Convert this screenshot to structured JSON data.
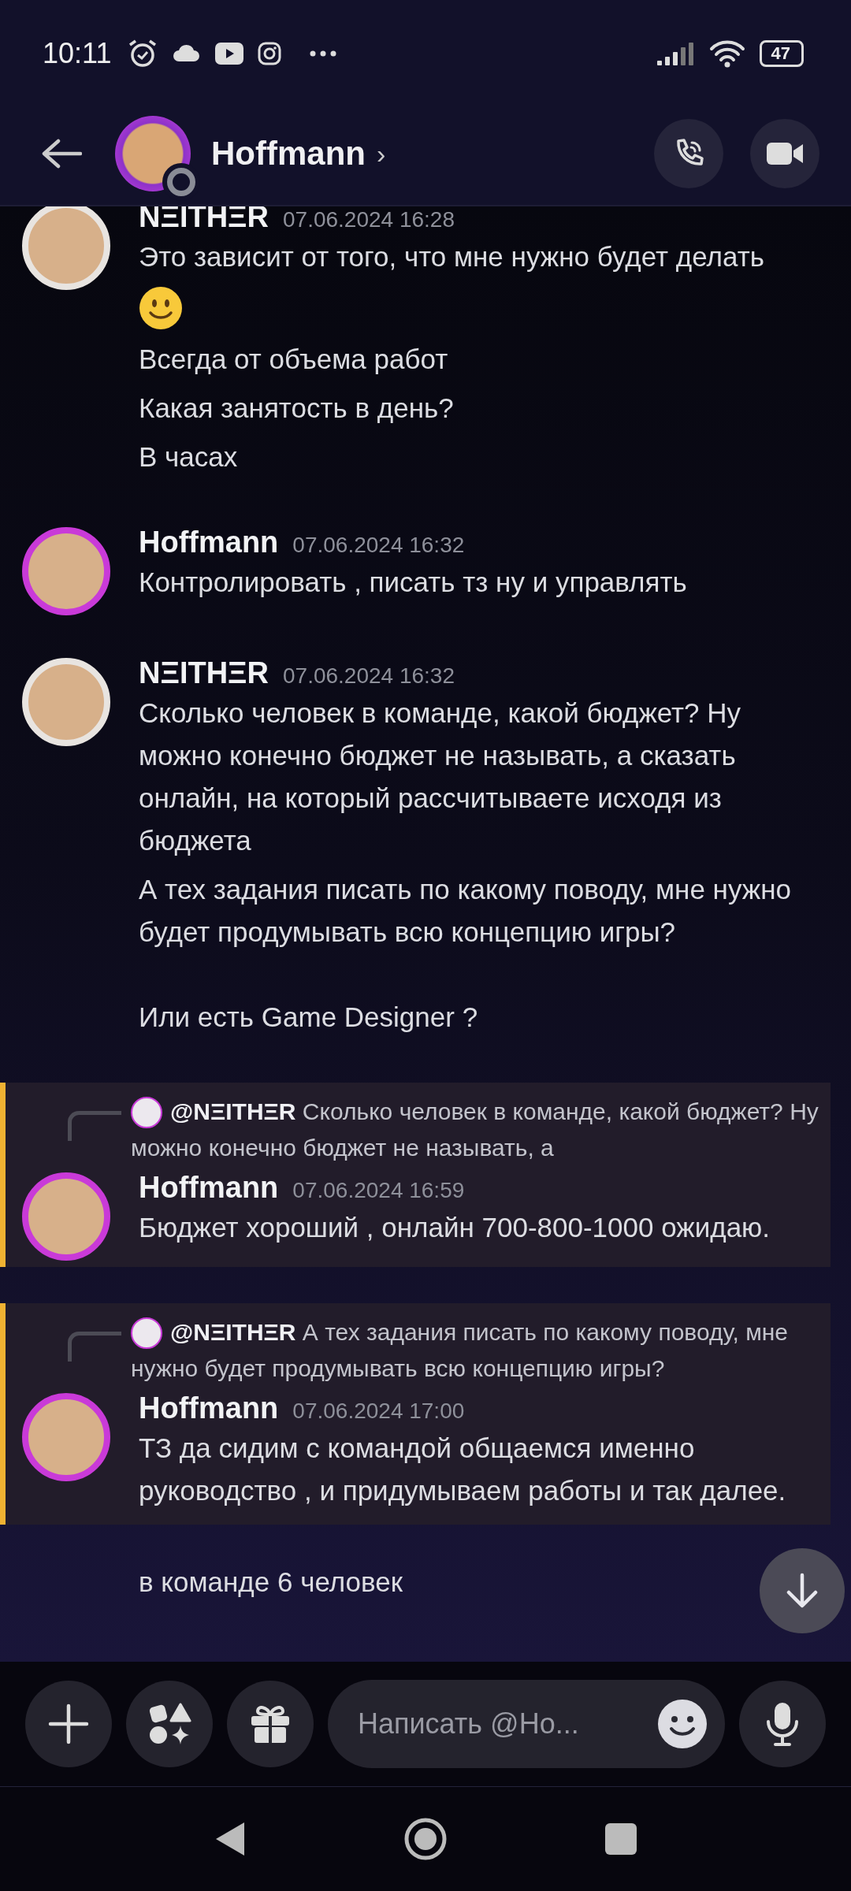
{
  "status_bar": {
    "time": "10:11",
    "battery": "47"
  },
  "header": {
    "title": "Hoffmann",
    "chevron": "›"
  },
  "messages": [
    {
      "kind": "group",
      "author": "NΞITHΞR",
      "time": "07.06.2024 16:28",
      "color": "#e8e4e0",
      "highlighted": false,
      "body": [
        {
          "kind": "text",
          "text": "Это зависит от того, что мне нужно будет делать"
        },
        {
          "kind": "emoji"
        },
        {
          "kind": "text",
          "text": "Всегда от объема работ"
        },
        {
          "kind": "text",
          "text": "Какая занятость в день?"
        },
        {
          "kind": "text",
          "text": "В часах"
        }
      ]
    },
    {
      "kind": "group",
      "author": "Hoffmann",
      "time": "07.06.2024 16:32",
      "color": "#c93ad8",
      "highlighted": false,
      "body": [
        {
          "kind": "text",
          "text": "Контролировать  , писать тз ну и управлять"
        }
      ]
    },
    {
      "kind": "group",
      "author": "NΞITHΞR",
      "time": "07.06.2024 16:32",
      "color": "#e8e4e0",
      "highlighted": false,
      "body": [
        {
          "kind": "text",
          "text": "Сколько человек в команде, какой бюджет? Ну можно конечно бюджет не называть, а сказать онлайн, на который рассчитываете исходя из бюджета"
        },
        {
          "kind": "text",
          "text": "А тех задания писать по какому поводу, мне нужно будет продумывать всю концепцию игры?\n\nИли есть Game Designer ?"
        }
      ]
    },
    {
      "kind": "reply",
      "author": "Hoffmann",
      "time": "07.06.2024 16:59",
      "color": "#c93ad8",
      "highlighted": true,
      "reply_author": "@NΞITHΞR",
      "reply_text": "Сколько человек в команде, какой бюджет? Ну можно конечно бюджет не называть, а",
      "body": [
        {
          "kind": "text",
          "text": "Бюджет хороший , онлайн 700-800-1000 ожидаю."
        }
      ]
    },
    {
      "kind": "reply",
      "author": "Hoffmann",
      "time": "07.06.2024 17:00",
      "color": "#c93ad8",
      "highlighted": true,
      "reply_author": "@NΞITHΞR",
      "reply_text": "А тех задания писать по какому поводу, мне нужно будет продумывать всю концепцию игры?",
      "body": [
        {
          "kind": "text",
          "text": "ТЗ да сидим с командой общаемся именно руководство , и придумываем работы и так далее."
        }
      ]
    },
    {
      "kind": "continuation",
      "highlighted": false,
      "body": [
        {
          "kind": "text",
          "text": "в команде 6 человек"
        }
      ]
    }
  ],
  "composer": {
    "placeholder": "Написать @Ho..."
  }
}
